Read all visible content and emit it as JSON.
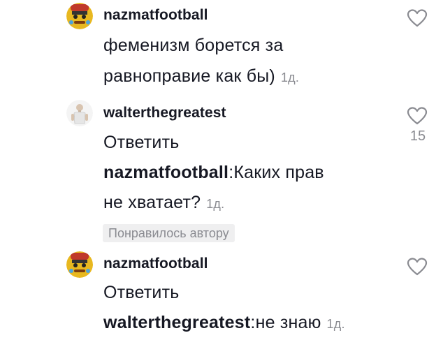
{
  "comments": [
    {
      "username": "nazmatfootball",
      "lines": [
        "феменизм борется за",
        "равноправие как бы)"
      ],
      "time": "1д.",
      "avatar": "emoji-avatar-icon"
    },
    {
      "username": "walterthegreatest",
      "reply_label": "Ответить",
      "mention": "nazmatfootball",
      "text_line1": ":Каких прав",
      "text_line2": "не хватает?",
      "time": "1д.",
      "likes": "15",
      "creator_badge": "Понравилось автору",
      "avatar": "person-avatar-icon"
    },
    {
      "username": "nazmatfootball",
      "reply_label": "Ответить",
      "mention": "walterthegreatest",
      "text": ":не знаю",
      "time": "1д.",
      "avatar": "emoji-avatar-icon"
    }
  ],
  "colors": {
    "text": "#161823",
    "muted": "#8a8b91",
    "badge_bg": "#efeff0"
  },
  "icons": {
    "like": "heart-outline-icon"
  }
}
